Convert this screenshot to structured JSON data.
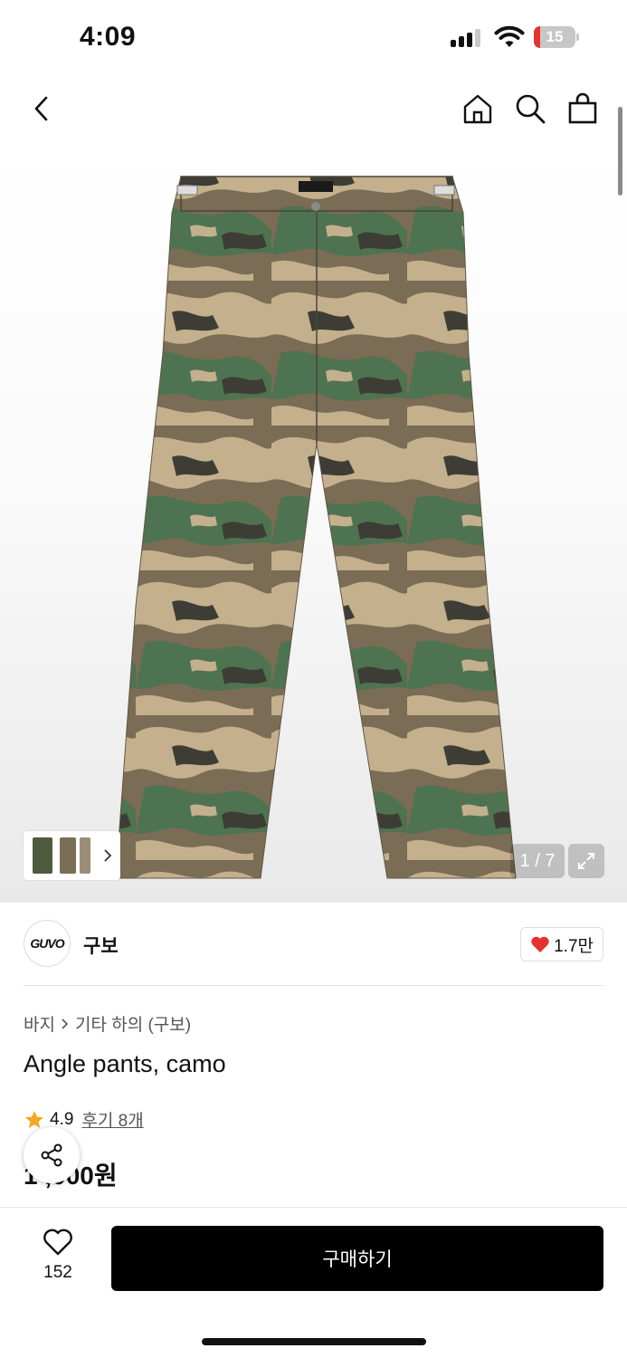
{
  "status_bar": {
    "time": "4:09",
    "battery": "15",
    "battery_level": 0.15
  },
  "nav": {
    "back_icon": "chevron-left-icon",
    "home_icon": "home-icon",
    "search_icon": "search-icon",
    "cart_icon": "shopping-bag-icon"
  },
  "gallery": {
    "counter": "1 / 7",
    "expand_icon": "expand-icon",
    "thumbnails": 3
  },
  "brand": {
    "logo_text": "GUVO",
    "name": "구보",
    "likes": "1.7만"
  },
  "breadcrumb": {
    "category": "바지",
    "subcategory": "기타 하의 (구보)"
  },
  "product": {
    "title": "Angle pants, camo",
    "rating": "4.9",
    "reviews": "후기 8개",
    "price": "1 ,000원"
  },
  "bottom_bar": {
    "wishlist_count": "152",
    "buy_label": "구매하기"
  },
  "colors": {
    "accent": "#000000",
    "heart": "#e5322d",
    "star": "#f5a623"
  }
}
